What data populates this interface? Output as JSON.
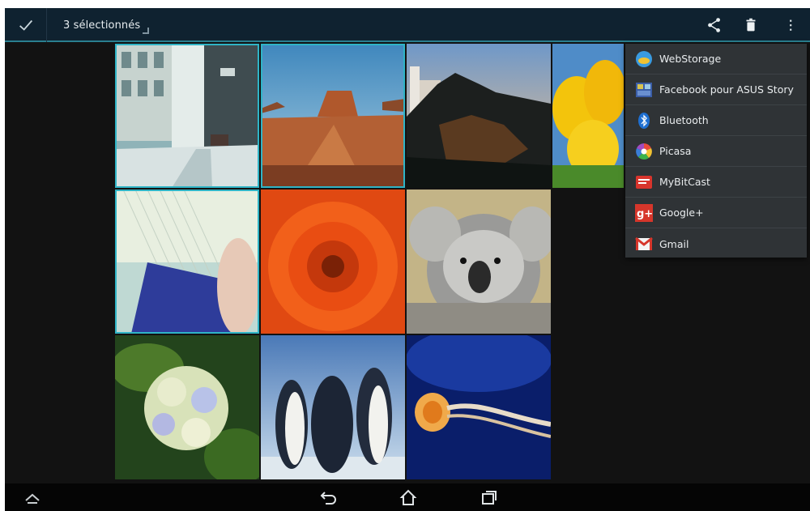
{
  "action_bar": {
    "selection_title": "3 sélectionnés",
    "icons": [
      "done-check-icon",
      "share-icon",
      "trash-icon",
      "overflow-menu-icon"
    ]
  },
  "colors": {
    "action_bar": "#0f2230",
    "accent": "#2fb4c6",
    "menu_bg": "#2f3336",
    "background": "#121212"
  },
  "gallery": {
    "tiles": [
      {
        "subject": "snowy-street-photo",
        "selected": true
      },
      {
        "subject": "desert-butte-photo",
        "selected": true
      },
      {
        "subject": "lighthouse-coast-photo",
        "selected": false
      },
      {
        "subject": "yellow-tulips-photo",
        "selected": false
      },
      {
        "subject": "notebook-hand-photo",
        "selected": true
      },
      {
        "subject": "orange-chrysanthemum-photo",
        "selected": false
      },
      {
        "subject": "koala-photo",
        "selected": false
      },
      {
        "subject": "hydrangea-photo",
        "selected": false
      },
      {
        "subject": "penguins-photo",
        "selected": false
      },
      {
        "subject": "jellyfish-photo",
        "selected": false
      }
    ]
  },
  "share_menu": {
    "items": [
      {
        "label": "WebStorage",
        "icon": "webstorage-icon"
      },
      {
        "label": "Facebook pour ASUS Story",
        "icon": "asus-story-icon"
      },
      {
        "label": "Bluetooth",
        "icon": "bluetooth-icon"
      },
      {
        "label": "Picasa",
        "icon": "picasa-icon"
      },
      {
        "label": "MyBitCast",
        "icon": "mybitcast-icon"
      },
      {
        "label": "Google+",
        "icon": "google-plus-icon"
      },
      {
        "label": "Gmail",
        "icon": "gmail-icon"
      }
    ]
  },
  "nav_bar": {
    "icons": [
      "up-chevron-icon",
      "back-icon",
      "home-icon",
      "recents-icon"
    ]
  }
}
